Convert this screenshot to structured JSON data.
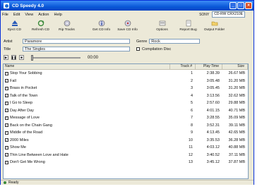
{
  "window": {
    "title": "CD Speedy 4.0"
  },
  "menu": [
    "File",
    "Edit",
    "View",
    "Action",
    "Help"
  ],
  "drive": {
    "label": "SONY",
    "selected": "CD-RW CRX210E"
  },
  "toolbar": [
    {
      "label": "Eject CD",
      "icon": "eject-icon"
    },
    {
      "label": "Refresh CD",
      "icon": "refresh-icon"
    },
    {
      "label": "Rip Tracks",
      "icon": "rip-tracks-icon"
    },
    {
      "label": "Get CD Info",
      "icon": "get-info-icon"
    },
    {
      "label": "Save CD Info",
      "icon": "save-info-icon"
    },
    {
      "label": "Options",
      "icon": "options-icon"
    },
    {
      "label": "Report Bug",
      "icon": "report-bug-icon"
    },
    {
      "label": "Output Folder",
      "icon": "folder-icon"
    }
  ],
  "fields": {
    "artist_label": "Artist",
    "artist_value": "Paramore",
    "genre_label": "Genre",
    "genre_value": "Rock",
    "title_label": "Title",
    "title_value": "The Singles",
    "compilation_label": "Compilation Disc"
  },
  "player": {
    "time": "00:00"
  },
  "table": {
    "headers": [
      "Name",
      "Track #",
      "Play Time",
      "Size"
    ],
    "rows": [
      {
        "name": "Stop Your Sobbing",
        "track": "1",
        "time": "2:38.39",
        "size": "26.67 MB"
      },
      {
        "name": "Fall",
        "track": "2",
        "time": "3:05.48",
        "size": "31.20 MB"
      },
      {
        "name": "Brass in Pocket",
        "track": "3",
        "time": "3:05.45",
        "size": "31.20 MB"
      },
      {
        "name": "Talk of the Town",
        "track": "4",
        "time": "3:13.56",
        "size": "32.62 MB"
      },
      {
        "name": "I Go to Sleep",
        "track": "5",
        "time": "2:57.60",
        "size": "29.88 MB"
      },
      {
        "name": "Day After Day",
        "track": "6",
        "time": "4:01.15",
        "size": "40.71 MB"
      },
      {
        "name": "Message of Love",
        "track": "7",
        "time": "3:28.55",
        "size": "35.09 MB"
      },
      {
        "name": "Back on the Chain Gang",
        "track": "8",
        "time": "3:52.31",
        "size": "39.11 MB"
      },
      {
        "name": "Middle of the Road",
        "track": "9",
        "time": "4:13.45",
        "size": "42.65 MB"
      },
      {
        "name": "2000 Miles",
        "track": "10",
        "time": "3:35.53",
        "size": "36.28 MB"
      },
      {
        "name": "Show Me",
        "track": "11",
        "time": "4:03.12",
        "size": "40.88 MB"
      },
      {
        "name": "Thin Line Between Love and Hate",
        "track": "12",
        "time": "3:40.52",
        "size": "37.11 MB"
      },
      {
        "name": "Don't Get Me Wrong",
        "track": "13",
        "time": "3:45.12",
        "size": "37.87 MB"
      }
    ]
  },
  "status": {
    "text": "Ready"
  },
  "colors": {
    "titlebar": "#0a58d8",
    "chrome": "#ece9d8",
    "close": "#d9512a"
  }
}
